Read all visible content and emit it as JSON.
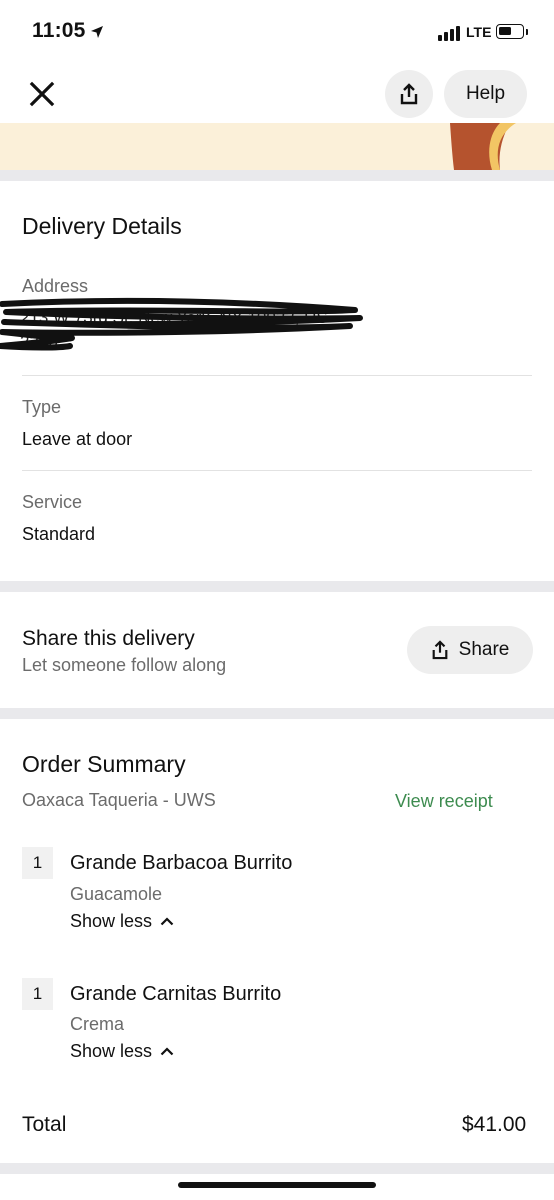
{
  "status_bar": {
    "time": "11:05",
    "network": "LTE",
    "location_icon": "location-arrow-icon",
    "signal_icon": "signal-bars-icon",
    "battery_icon": "battery-icon"
  },
  "header": {
    "close_icon": "close-icon",
    "share_icon": "share-icon",
    "help_label": "Help"
  },
  "delivery_details": {
    "title": "Delivery Details",
    "address_label": "Address",
    "address_value": "213 W 73rd St, New York, NY 10023, US 2306",
    "type_label": "Type",
    "type_value": "Leave at door",
    "service_label": "Service",
    "service_value": "Standard"
  },
  "share_delivery": {
    "title": "Share this delivery",
    "subtitle": "Let someone follow along",
    "button_label": "Share",
    "button_icon": "share-icon"
  },
  "order_summary": {
    "title": "Order Summary",
    "restaurant": "Oaxaca Taqueria - UWS",
    "view_receipt": "View receipt",
    "items": [
      {
        "qty": "1",
        "name": "Grande Barbacoa Burrito",
        "option": "Guacamole",
        "toggle": "Show less"
      },
      {
        "qty": "1",
        "name": "Grande Carnitas Burrito",
        "option": "Crema",
        "toggle": "Show less"
      }
    ],
    "total_label": "Total",
    "total_value": "$41.00"
  },
  "colors": {
    "accent_green": "#3d8b4f",
    "hero_bg": "#fbf0d9",
    "divider": "#e9e9ec",
    "pill_bg": "#eeeeee"
  }
}
